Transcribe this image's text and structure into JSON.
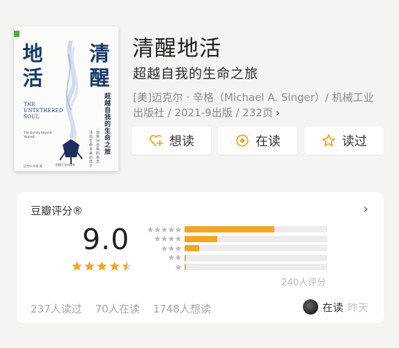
{
  "book": {
    "title": "清醒地活",
    "subtitle": "超越自我的生命之旅",
    "meta_line1": "[美]迈克尔 · 辛格（Michael A. Singer）/ 机械工业",
    "meta_line2": "出版社 / 2021-9出版 / 232页",
    "cover": {
      "title_left": "地活",
      "title_right": "清醒",
      "en_title": "THE UNTETHERED SOUL",
      "en_sub": "The Journey Beyond Yourself",
      "subtitle_vertical": "超越自我的生命之旅",
      "tagline_1": "放弃对自我的执念",
      "tagline_2": "活出生命本来的样子",
      "authors": "迈克尔·辛格 著",
      "publisher": "机械工业出版社"
    }
  },
  "actions": {
    "want": "想读",
    "reading": "在读",
    "read": "读过"
  },
  "rating": {
    "label": "豆瓣评分®",
    "score": "9.0",
    "stars": 4.5,
    "distribution": [
      {
        "stars": 5,
        "percent": 0.63
      },
      {
        "stars": 4,
        "percent": 0.23
      },
      {
        "stars": 3,
        "percent": 0.1
      },
      {
        "stars": 2,
        "percent": 0.01
      },
      {
        "stars": 1,
        "percent": 0.005
      }
    ],
    "count_text": "240人评分",
    "footer": {
      "read": "237人读过",
      "reading": "70人在读",
      "want": "1748人想读"
    },
    "friend": {
      "status": "在读",
      "time": "昨天"
    }
  },
  "colors": {
    "star": "#f4a623",
    "star_gray": "#bdbdbd",
    "background": "#f4f4f2"
  }
}
